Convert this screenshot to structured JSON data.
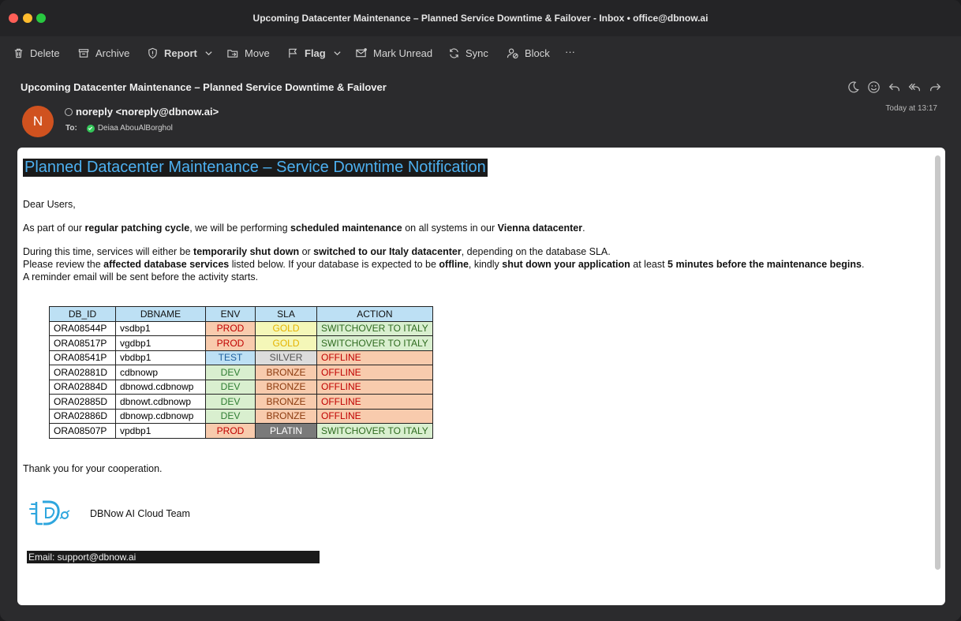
{
  "window": {
    "title": "Upcoming Datacenter Maintenance – Planned Service Downtime & Failover - Inbox • office@dbnow.ai"
  },
  "toolbar": {
    "delete": "Delete",
    "archive": "Archive",
    "report": "Report",
    "move": "Move",
    "flag": "Flag",
    "mark_unread": "Mark Unread",
    "sync": "Sync",
    "block": "Block",
    "more": "···"
  },
  "header": {
    "subject": "Upcoming Datacenter Maintenance – Planned Service Downtime & Failover",
    "avatar_initial": "N",
    "sender": "noreply <noreply@dbnow.ai>",
    "to_label": "To:",
    "recipient": "Deiaa AbouAlBorghol",
    "date": "Today at 13:17"
  },
  "body": {
    "heading": "Planned Datacenter Maintenance – Service Downtime Notification",
    "greeting": "Dear Users,",
    "p1": {
      "a": "As part of our ",
      "b": "regular patching cycle",
      "c": ", we will be performing ",
      "d": "scheduled maintenance",
      "e": " on all systems in our ",
      "f": "Vienna datacenter",
      "g": "."
    },
    "p2": {
      "a": "During this time, services will either be ",
      "b": "temporarily shut down",
      "c": " or ",
      "d": "switched to our Italy datacenter",
      "e": ", depending on the database SLA."
    },
    "p3": {
      "a": "Please review the ",
      "b": "affected database services",
      "c": " listed below. If your database is expected to be ",
      "d": "offline",
      "e": ", kindly ",
      "f": "shut down your application",
      "g": " at least ",
      "h": "5 minutes before the maintenance begins",
      "i": "."
    },
    "p4": "A reminder email will be sent before the activity starts.",
    "thanks": "Thank you for your cooperation.",
    "team": "DBNow AI Cloud Team",
    "email": "Email: support@dbnow.ai"
  },
  "table": {
    "headers": [
      "DB_ID",
      "DBNAME",
      "ENV",
      "SLA",
      "ACTION"
    ],
    "rows": [
      [
        "ORA08544P",
        "vsdbp1",
        "PROD",
        "GOLD",
        "SWITCHOVER TO ITALY"
      ],
      [
        "ORA08517P",
        "vgdbp1",
        "PROD",
        "GOLD",
        "SWITCHOVER TO ITALY"
      ],
      [
        "ORA08541P",
        "vbdbp1",
        "TEST",
        "SILVER",
        "OFFLINE"
      ],
      [
        "ORA02881D",
        "cdbnowp",
        "DEV",
        "BRONZE",
        "OFFLINE"
      ],
      [
        "ORA02884D",
        "dbnowd.cdbnowp",
        "DEV",
        "BRONZE",
        "OFFLINE"
      ],
      [
        "ORA02885D",
        "dbnowt.cdbnowp",
        "DEV",
        "BRONZE",
        "OFFLINE"
      ],
      [
        "ORA02886D",
        "dbnowp.cdbnowp",
        "DEV",
        "BRONZE",
        "OFFLINE"
      ],
      [
        "ORA08507P",
        "vpdbp1",
        "PROD",
        "PLATIN",
        "SWITCHOVER TO ITALY"
      ]
    ]
  },
  "colors": {
    "env": {
      "PROD": {
        "bg": "#f8cbad",
        "fg": "#c00000"
      },
      "TEST": {
        "bg": "#bde0f4",
        "fg": "#1f5f9f"
      },
      "DEV": {
        "bg": "#d9efcf",
        "fg": "#2e7d32"
      }
    },
    "sla": {
      "GOLD": {
        "bg": "#f4f7b8",
        "fg": "#e5b400"
      },
      "SILVER": {
        "bg": "#dcdcdc",
        "fg": "#555555"
      },
      "BRONZE": {
        "bg": "#f8cbad",
        "fg": "#8b3a0e"
      },
      "PLATIN": {
        "bg": "#7a7a7a",
        "fg": "#ffffff"
      }
    },
    "action": {
      "SWITCHOVER TO ITALY": {
        "bg": "#d9efcf",
        "fg": "#2e6b1f"
      },
      "OFFLINE": {
        "bg": "#f8cbad",
        "fg": "#c00000"
      }
    },
    "avatar": "#d0521f",
    "heading_text": "#4db0f0"
  }
}
